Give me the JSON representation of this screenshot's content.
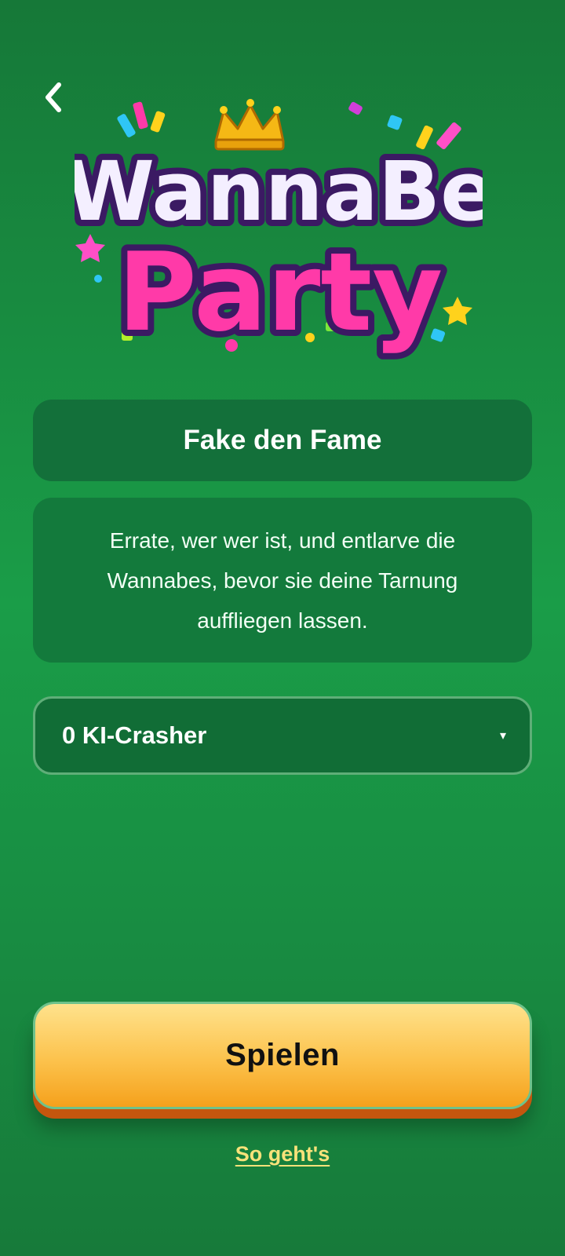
{
  "header": {
    "back_icon": "chevron-left-icon"
  },
  "logo": {
    "line1": "WannaBe",
    "line2": "Party",
    "crown_icon": "crown-icon"
  },
  "game": {
    "title": "Fake den Fame",
    "description": "Errate, wer wer ist, und entlarve die Wannabes, bevor sie deine Tarnung auffliegen lassen."
  },
  "crasher_select": {
    "value": "0 KI-Crasher",
    "caret": "▾"
  },
  "actions": {
    "play_label": "Spielen",
    "howto_label": "So geht's"
  },
  "colors": {
    "background": "#1a9d48",
    "card": "#13703a",
    "play_button": "#fcc24c",
    "link": "#f7e27a"
  }
}
